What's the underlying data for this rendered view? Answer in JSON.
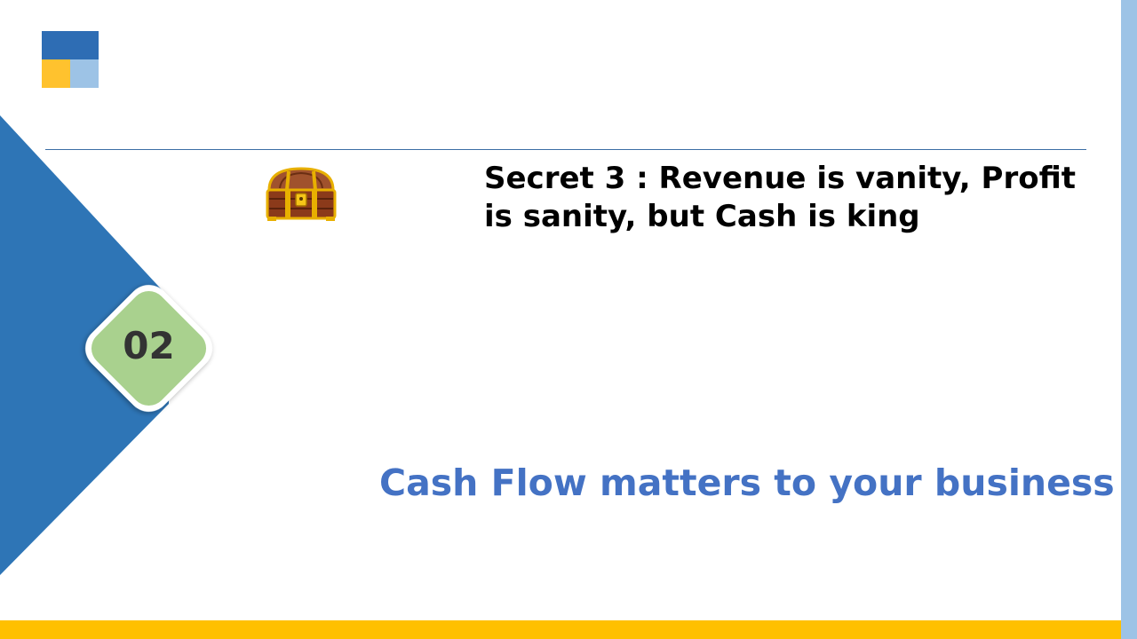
{
  "slide": {
    "section_number": "02",
    "title": "Secret 3 : Revenue is vanity, Profit is sanity, but Cash is king",
    "subtitle": "Cash Flow matters to your business"
  },
  "icons": {
    "logo": "four-square-logo",
    "chest": "treasure-chest-icon"
  },
  "colors": {
    "accent_blue": "#2e75b6",
    "light_blue": "#9dc3e6",
    "yellow": "#ffc000",
    "badge_green": "#a9d18e",
    "subtitle_blue": "#4472c4"
  }
}
